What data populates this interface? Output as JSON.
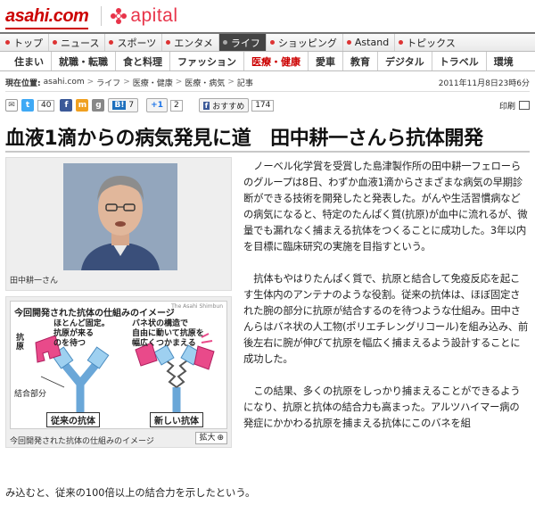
{
  "header": {
    "asahi_logo": "asahi.com",
    "apital_logo": "apital"
  },
  "nav_primary": [
    {
      "label": "トップ"
    },
    {
      "label": "ニュース"
    },
    {
      "label": "スポーツ"
    },
    {
      "label": "エンタメ"
    },
    {
      "label": "ライフ",
      "active": true
    },
    {
      "label": "ショッピング"
    },
    {
      "label": "Astand"
    },
    {
      "label": "トピックス"
    }
  ],
  "nav_secondary": [
    {
      "label": "住まい"
    },
    {
      "label": "就職・転職"
    },
    {
      "label": "食と料理"
    },
    {
      "label": "ファッション"
    },
    {
      "label": "医療・健康",
      "active": true
    },
    {
      "label": "愛車"
    },
    {
      "label": "教育"
    },
    {
      "label": "デジタル"
    },
    {
      "label": "トラベル"
    },
    {
      "label": "環境"
    }
  ],
  "breadcrumb": {
    "label": "現在位置:",
    "items": [
      "asahi.com",
      "ライフ",
      "医療・健康",
      "医療・病気",
      "記事"
    ],
    "date": "2011年11月8日23時6分"
  },
  "share": {
    "twitter_count": "40",
    "hatena_label": "7",
    "plusone_label": "+1",
    "plusone_count": "2",
    "recommend_label": "おすすめ",
    "recommend_count": "174",
    "print_label": "印刷"
  },
  "article": {
    "title": "血液1滴からの病気発見に道　田中耕一さんら抗体開発",
    "photo_caption": "田中耕一さん",
    "diagram": {
      "title": "今回開発された抗体の仕組みのイメージ",
      "credit": "The Asahi Shimbun",
      "note_left": [
        "ほとんど固定。",
        "抗原が来る",
        "のを待つ"
      ],
      "note_right": [
        "バネ状の構造で",
        "自由に動いて抗原を",
        "幅広くつかまえる"
      ],
      "antigen_label": "抗原",
      "binding_label": "結合部分",
      "old_label": "従来の抗体",
      "new_label": "新しい抗体"
    },
    "diagram_caption": "今回開発された抗体の仕組みのイメージ",
    "zoom_label": "拡大",
    "paragraphs": [
      "ノーベル化学賞を受賞した島津製作所の田中耕一フェローらのグループは8日、わずか血液1滴からさまざまな病気の早期診断ができる技術を開発したと発表した。がんや生活習慣病などの病気になると、特定のたんぱく質(抗原)が血中に流れるが、微量でも漏れなく捕まえる抗体をつくることに成功した。3年以内を目標に臨床研究の実施を目指すという。",
      "抗体もやはりたんぱく質で、抗原と結合して免疫反応を起こす生体内のアンテナのような役割。従来の抗体は、ほぼ固定された腕の部分に抗原が結合するのを待つような仕組み。田中さんらはバネ状の人工物(ポリエチレングリコール)を組み込み、前後左右に腕が伸びて抗原を幅広く捕まえるよう設計することに成功した。",
      "この結果、多くの抗原をしっかり捕まえることができるようになり、抗原と抗体の結合力も高まった。アルツハイマー病の発症にかかわる抗原を捕まえる抗体にこのバネを組"
    ],
    "last_line": "み込むと、従来の100倍以上の結合力を示したという。"
  }
}
